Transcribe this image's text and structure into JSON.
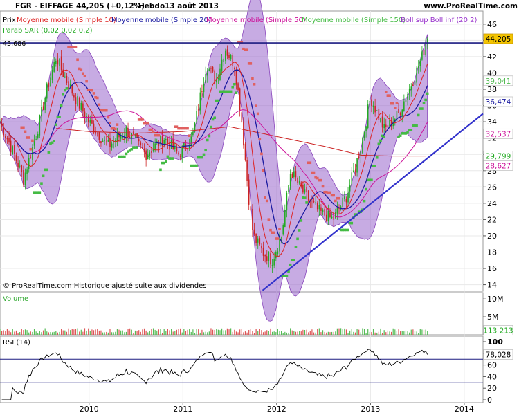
{
  "header": {
    "ticker": "FGR - EIFFAGE",
    "price": "44,205 (+0,12%)",
    "period": "Hebdo",
    "date": "13 août 2013",
    "website": "www.ProRealTime.com"
  },
  "legend": {
    "prix": "Prix",
    "ma10": "Moyenne mobile (Simple 10)",
    "ma20": "Moyenne mobile (Simple 20)",
    "ma50": "Moyenne mobile (Simple 50)",
    "ma150": "Moyenne mobile (Simple 150)",
    "boll": "Boll sup Boll inf (20 2)",
    "sar": "Parab SAR (0,02 0,02 0,2)"
  },
  "colors": {
    "ma10": "#dd2222",
    "ma20": "#1a1aa0",
    "ma50": "#cc1199",
    "ma150": "#55cc55",
    "boll_fill": "#9966cc",
    "sar_up": "#44bb44",
    "sar_down": "#e06060",
    "trend": "#3333cc"
  },
  "copyright": "© ProRealTime.com  Historique ajusté suite aux dividendes",
  "hline_label": "43,686",
  "price_badges": [
    {
      "value": 44.205,
      "text": "44,205",
      "bg": "#f3c400",
      "fg": "#000000"
    },
    {
      "value": 39.041,
      "text": "39,041",
      "bg": "#ffffff",
      "fg": "#55bb55"
    },
    {
      "value": 36.474,
      "text": "36,474",
      "bg": "#ffffff",
      "fg": "#1a1aa0"
    },
    {
      "value": 32.537,
      "text": "32,537",
      "bg": "#ffffff",
      "fg": "#cc1199"
    },
    {
      "value": 29.799,
      "text": "29,799",
      "bg": "#ffffff",
      "fg": "#22aa22"
    },
    {
      "value": 28.627,
      "text": "28,627",
      "bg": "#ffffff",
      "fg": "#cc1199"
    }
  ],
  "volume": {
    "label": "Volume",
    "ticks": [
      "10M",
      "5M"
    ],
    "badge": "113 213"
  },
  "rsi": {
    "label": "RSI (14)",
    "ticks": [
      "100",
      "80",
      "60",
      "40",
      "20",
      "0"
    ],
    "badge": "78,028",
    "levels": [
      70,
      30
    ]
  },
  "chart_data": {
    "type": "line",
    "price_axis": {
      "ylim": [
        13.2,
        47.6
      ],
      "ticks": [
        "46",
        "44",
        "42",
        "40",
        "38",
        "36",
        "34",
        "32",
        "30",
        "28",
        "26",
        "24",
        "22",
        "20",
        "18",
        "16",
        "14"
      ]
    },
    "x_labels": [
      "2010",
      "2011",
      "2012",
      "2013",
      "2014"
    ],
    "x_tick_dates": [
      2010.0,
      2011.0,
      2012.0,
      2013.0,
      2014.0
    ],
    "xlim": [
      2009.05,
      2014.2
    ],
    "close_anchors": {
      "t": [
        2009.05,
        2009.2,
        2009.3,
        2009.45,
        2009.55,
        2009.65,
        2009.72,
        2009.85,
        2010.0,
        2010.2,
        2010.4,
        2010.6,
        2010.8,
        2010.95,
        2011.1,
        2011.25,
        2011.35,
        2011.45,
        2011.55,
        2011.62,
        2011.7,
        2011.75,
        2011.85,
        2011.95,
        2012.05,
        2012.15,
        2012.3,
        2012.45,
        2012.6,
        2012.75,
        2012.9,
        2013.0,
        2013.15,
        2013.3,
        2013.45,
        2013.55,
        2013.6
      ],
      "v": [
        34,
        30,
        27,
        33,
        38,
        42,
        40,
        37,
        34,
        31,
        33,
        30,
        32,
        30,
        32,
        41,
        39,
        43,
        41,
        35,
        25,
        20,
        18,
        17,
        20,
        28,
        25,
        23,
        22,
        25,
        31,
        37,
        33,
        35,
        39,
        42,
        44.2
      ]
    },
    "ma150": {
      "t": [
        2009.65,
        2010.0,
        2010.5,
        2011.0,
        2011.5,
        2012.0,
        2012.5,
        2012.9,
        2013.2,
        2013.6
      ],
      "v": [
        33.2,
        32.8,
        32.6,
        32.8,
        33.4,
        32.2,
        31.0,
        29.9,
        29.8,
        29.8
      ]
    },
    "trendline": {
      "t": [
        2011.85,
        2014.2
      ],
      "v": [
        13.3,
        35.0
      ]
    },
    "hline_value": 43.686,
    "volume_max": 11000000,
    "volume_latest": 113213,
    "rsi_latest": 78.028
  }
}
